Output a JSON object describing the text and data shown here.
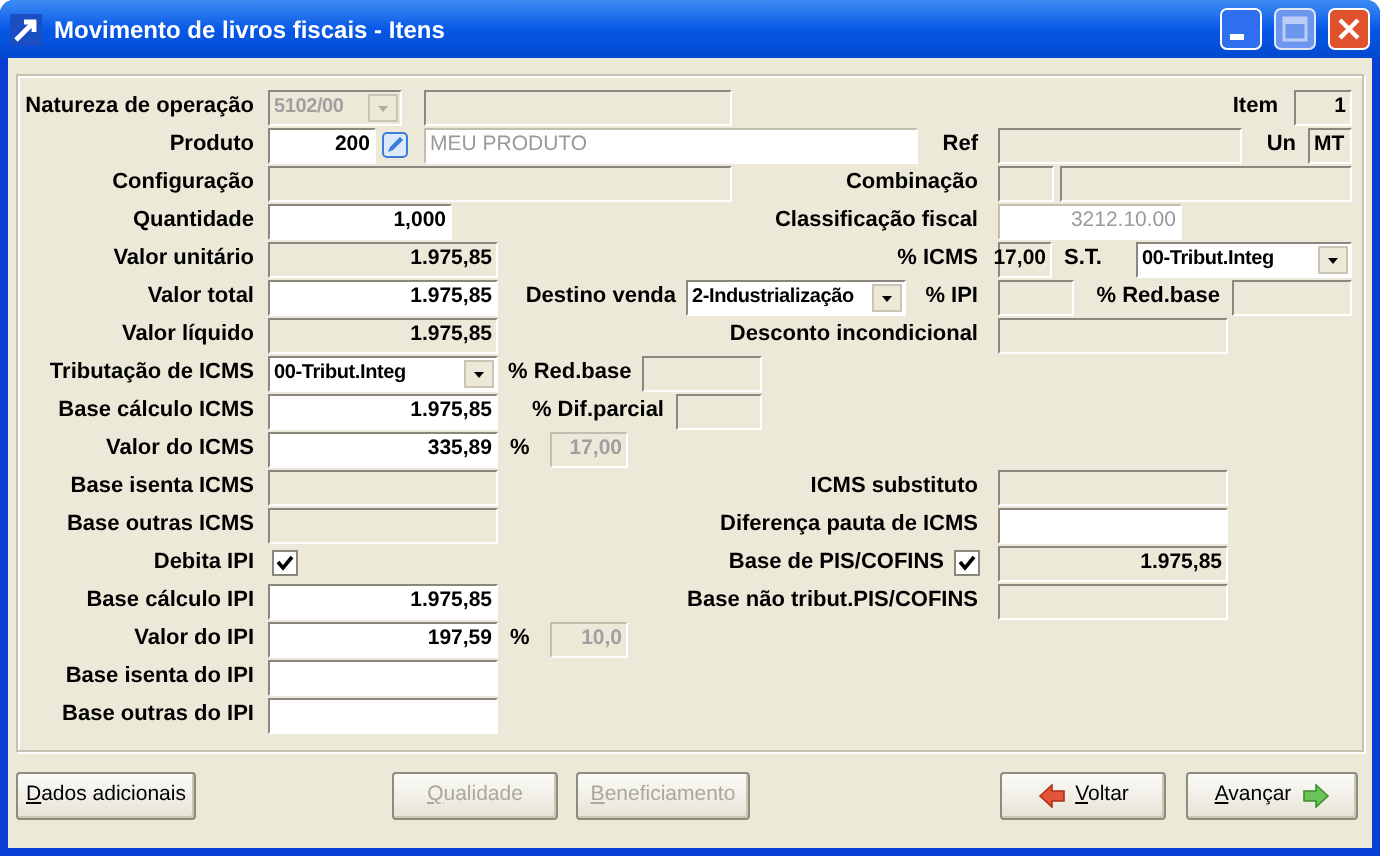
{
  "window": {
    "title": "Movimento de livros fiscais - Itens"
  },
  "rows": [
    [
      {
        "kind": "label",
        "text": "Natureza de operação"
      },
      {
        "kind": "combo",
        "value": "5102/00",
        "disabled": true
      },
      {
        "kind": "field",
        "readonly": true,
        "disabled": false
      },
      {
        "kind": "label",
        "text": "Item"
      },
      {
        "kind": "field",
        "value": "1",
        "readonly": true,
        "disabled": false
      }
    ],
    [
      {
        "kind": "label",
        "text": "Produto"
      },
      {
        "kind": "field",
        "value": "200",
        "readonly": false,
        "disabled": false
      },
      {
        "kind": "icon_button"
      },
      {
        "kind": "field",
        "value": "MEU PRODUTO",
        "readonly": false,
        "disabled": true
      },
      {
        "kind": "label",
        "text": "Ref"
      },
      {
        "kind": "field",
        "readonly": true,
        "disabled": false
      },
      {
        "kind": "label",
        "text": "Un"
      },
      {
        "kind": "field",
        "value": "MT",
        "readonly": true,
        "disabled": false
      }
    ],
    [
      {
        "kind": "label",
        "text": "Configuração"
      },
      {
        "kind": "field",
        "readonly": true,
        "disabled": false
      },
      {
        "kind": "label",
        "text": "Combinação"
      },
      {
        "kind": "field",
        "readonly": true,
        "disabled": false
      },
      {
        "kind": "field",
        "readonly": true,
        "disabled": false
      }
    ],
    [
      {
        "kind": "label",
        "text": "Quantidade"
      },
      {
        "kind": "field",
        "value": "1,000",
        "readonly": false,
        "disabled": false
      },
      {
        "kind": "label",
        "text": "Classificação fiscal"
      },
      {
        "kind": "field",
        "value": "3212.10.00",
        "readonly": false,
        "disabled": true
      }
    ],
    [
      {
        "kind": "label",
        "text": "Valor unitário"
      },
      {
        "kind": "field",
        "value": "1.975,85",
        "readonly": true,
        "disabled": false
      },
      {
        "kind": "label",
        "text": "% ICMS"
      },
      {
        "kind": "field",
        "value": "17,00",
        "readonly": true,
        "disabled": false
      },
      {
        "kind": "label",
        "text": "S.T."
      },
      {
        "kind": "combo",
        "value": "00-Tribut.Integ",
        "disabled": false
      }
    ],
    [
      {
        "kind": "label",
        "text": "Valor total"
      },
      {
        "kind": "field",
        "value": "1.975,85",
        "readonly": false,
        "disabled": false
      },
      {
        "kind": "label",
        "text": "Destino venda"
      },
      {
        "kind": "combo",
        "value": "2-Industrialização",
        "disabled": false
      },
      {
        "kind": "label",
        "text": "% IPI"
      },
      {
        "kind": "field",
        "readonly": true,
        "disabled": false
      },
      {
        "kind": "label",
        "text": "% Red.base"
      },
      {
        "kind": "field",
        "readonly": true,
        "disabled": false
      }
    ],
    [
      {
        "kind": "label",
        "text": "Valor líquido"
      },
      {
        "kind": "field",
        "value": "1.975,85",
        "readonly": true,
        "disabled": false
      },
      {
        "kind": "label",
        "text": "Desconto incondicional"
      },
      {
        "kind": "field",
        "readonly": true,
        "disabled": false
      }
    ],
    [
      {
        "kind": "label",
        "text": "Tributação de ICMS"
      },
      {
        "kind": "combo",
        "value": "00-Tribut.Integ",
        "disabled": false
      },
      {
        "kind": "label",
        "text": "% Red.base"
      },
      {
        "kind": "field",
        "readonly": true,
        "disabled": false
      }
    ],
    [
      {
        "kind": "label",
        "text": "Base cálculo ICMS"
      },
      {
        "kind": "field",
        "value": "1.975,85",
        "readonly": false,
        "disabled": false
      },
      {
        "kind": "label",
        "text": "% Dif.parcial"
      },
      {
        "kind": "field",
        "readonly": true,
        "disabled": false
      }
    ],
    [
      {
        "kind": "label",
        "text": "Valor do ICMS"
      },
      {
        "kind": "field",
        "value": "335,89",
        "readonly": false,
        "disabled": false
      },
      {
        "kind": "label",
        "text": "%"
      },
      {
        "kind": "field",
        "value": "17,00",
        "readonly": true,
        "disabled": true
      }
    ],
    [
      {
        "kind": "label",
        "text": "Base isenta ICMS"
      },
      {
        "kind": "field",
        "readonly": true,
        "disabled": false
      },
      {
        "kind": "label",
        "text": "ICMS substituto"
      },
      {
        "kind": "field",
        "readonly": true,
        "disabled": false
      }
    ],
    [
      {
        "kind": "label",
        "text": "Base outras ICMS"
      },
      {
        "kind": "field",
        "readonly": true,
        "disabled": false
      },
      {
        "kind": "label",
        "text": "Diferença pauta de ICMS"
      },
      {
        "kind": "field",
        "readonly": false,
        "disabled": false
      }
    ],
    [
      {
        "kind": "label",
        "text": "Debita IPI"
      },
      {
        "kind": "checkbox",
        "checked": true
      },
      {
        "kind": "label",
        "text": "Base de PIS/COFINS"
      },
      {
        "kind": "checkbox",
        "checked": true
      },
      {
        "kind": "field",
        "value": "1.975,85",
        "readonly": true,
        "disabled": false
      }
    ],
    [
      {
        "kind": "label",
        "text": "Base cálculo IPI"
      },
      {
        "kind": "field",
        "value": "1.975,85",
        "readonly": false,
        "disabled": false
      },
      {
        "kind": "label",
        "text": "Base não tribut.PIS/COFINS"
      },
      {
        "kind": "field",
        "readonly": true,
        "disabled": false
      }
    ],
    [
      {
        "kind": "label",
        "text": "Valor do IPI"
      },
      {
        "kind": "field",
        "value": "197,59",
        "readonly": false,
        "disabled": false
      },
      {
        "kind": "label",
        "text": "%"
      },
      {
        "kind": "field",
        "value": "10,0",
        "readonly": true,
        "disabled": true
      }
    ],
    [
      {
        "kind": "label",
        "text": "Base isenta do IPI"
      },
      {
        "kind": "field",
        "readonly": false,
        "disabled": false
      }
    ],
    [
      {
        "kind": "label",
        "text": "Base outras do IPI"
      },
      {
        "kind": "field",
        "readonly": false,
        "disabled": false
      }
    ]
  ],
  "buttons": [
    {
      "label": "Dados adicionais",
      "disabled": false,
      "kind": "plain"
    },
    {
      "label": "Qualidade",
      "disabled": true,
      "kind": "plain"
    },
    {
      "label": "Beneficiamento",
      "disabled": true,
      "kind": "plain"
    },
    {
      "label": "Voltar",
      "disabled": false,
      "kind": "back"
    },
    {
      "label": "Avançar",
      "disabled": false,
      "kind": "forward"
    }
  ]
}
